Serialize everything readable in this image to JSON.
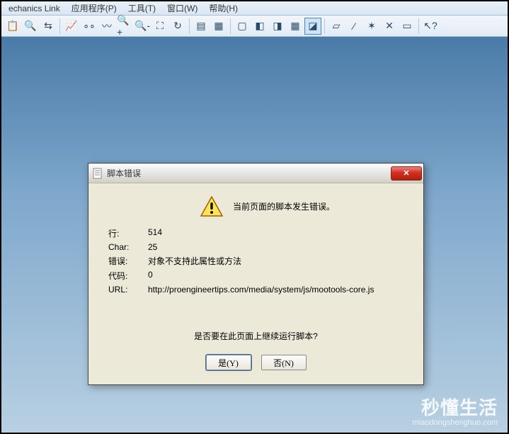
{
  "menu": {
    "items": [
      "echanics Link",
      "应用程序(P)",
      "工具(T)",
      "窗口(W)",
      "帮助(H)"
    ]
  },
  "dialog": {
    "title": "脚本错误",
    "headline": "当前页面的脚本发生错误。",
    "row_label_line": "行:",
    "row_label_char": "Char:",
    "row_label_err": "错误:",
    "row_label_code": "代码:",
    "row_label_url": "URL:",
    "line": "514",
    "char": "25",
    "err": "对象不支持此属性或方法",
    "code": "0",
    "url": "http://proengineertips.com/media/system/js/mootools-core.js",
    "question": "是否要在此页面上继续运行脚本?",
    "yes": "是(Y)",
    "no": "否(N)"
  },
  "watermark": {
    "big": "秒懂生活",
    "small": "miaodongshenghuo.com"
  }
}
